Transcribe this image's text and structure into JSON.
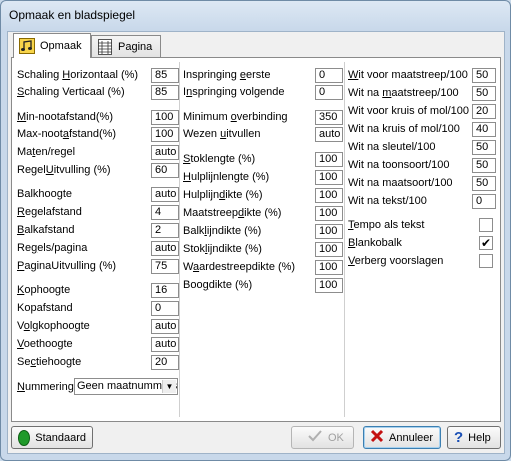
{
  "window": {
    "title": "Opmaak en bladspiegel"
  },
  "tabs": [
    {
      "label": "Opmaak"
    },
    {
      "label": "Pagina"
    }
  ],
  "col1": [
    {
      "pre": "Schaling ",
      "u": "H",
      "post": "orizontaal (%)",
      "value": "85"
    },
    {
      "pre": "",
      "u": "S",
      "post": "chaling Verticaal (%)",
      "value": "85"
    },
    {
      "pre": "",
      "u": "M",
      "post": "in-nootafstand(%)",
      "value": "100"
    },
    {
      "pre": "Max-noot",
      "u": "a",
      "post": "fstand(%)",
      "value": "100"
    },
    {
      "pre": "Ma",
      "u": "t",
      "post": "en/regel",
      "value": "auto"
    },
    {
      "pre": "Regel",
      "u": "U",
      "post": "itvulling (%)",
      "value": "60"
    },
    {
      "pre": "Balkhoogte",
      "u": "",
      "post": "",
      "value": "auto"
    },
    {
      "pre": "",
      "u": "R",
      "post": "egelafstand",
      "value": "4"
    },
    {
      "pre": "",
      "u": "B",
      "post": "alkafstand",
      "value": "2"
    },
    {
      "pre": "Re",
      "u": "g",
      "post": "els/pagina",
      "value": "auto"
    },
    {
      "pre": "",
      "u": "P",
      "post": "aginaUitvulling (%)",
      "value": "75"
    },
    {
      "pre": "",
      "u": "K",
      "post": "ophoogte",
      "value": "16"
    },
    {
      "pre": "Kopafstand",
      "u": "",
      "post": "",
      "value": "0"
    },
    {
      "pre": "V",
      "u": "o",
      "post": "lgkophoogte",
      "value": "auto"
    },
    {
      "pre": "",
      "u": "V",
      "post": "oethoogte",
      "value": "auto"
    },
    {
      "pre": "Se",
      "u": "c",
      "post": "tiehoogte",
      "value": "20"
    }
  ],
  "numbering": {
    "pre": "",
    "u": "N",
    "post": "ummering",
    "value": "Geen maatnummers"
  },
  "col2": [
    {
      "pre": "Inspringing ",
      "u": "e",
      "post": "erste",
      "value": "0"
    },
    {
      "pre": "I",
      "u": "n",
      "post": "springing volgende",
      "value": "0"
    },
    {
      "pre": "Minimum ",
      "u": "o",
      "post": "verbinding",
      "value": "350"
    },
    {
      "pre": "Wezen ",
      "u": "u",
      "post": "itvullen",
      "value": "auto"
    },
    {
      "pre": "",
      "u": "S",
      "post": "toklengte (%)",
      "value": "100"
    },
    {
      "pre": "",
      "u": "H",
      "post": "ulplijnlengte (%)",
      "value": "100"
    },
    {
      "pre": "Hulplijn",
      "u": "d",
      "post": "ikte (%)",
      "value": "100"
    },
    {
      "pre": "Maatstreep",
      "u": "d",
      "post": "ikte (%)",
      "value": "100"
    },
    {
      "pre": "Balk",
      "u": "l",
      "post": "ijndikte (%)",
      "value": "100"
    },
    {
      "pre": "Stok",
      "u": "l",
      "post": "ijndikte (%)",
      "value": "100"
    },
    {
      "pre": "W",
      "u": "a",
      "post": "ardestreepdikte (%)",
      "value": "100"
    },
    {
      "pre": "Boo",
      "u": "g",
      "post": "dikte (%)",
      "value": "100"
    }
  ],
  "col3": [
    {
      "pre": "",
      "u": "W",
      "post": "it voor maatstreep/100",
      "value": "50"
    },
    {
      "pre": "Wit na ",
      "u": "m",
      "post": "aatstreep/100",
      "value": "50"
    },
    {
      "pre": "Wit voor kruis of mol/100",
      "u": "",
      "post": "",
      "value": "20"
    },
    {
      "pre": "Wit na kruis of mol/100",
      "u": "",
      "post": "",
      "value": "40"
    },
    {
      "pre": "Wit na sleutel/100",
      "u": "",
      "post": "",
      "value": "50"
    },
    {
      "pre": "Wit na toonsoort/100",
      "u": "",
      "post": "",
      "value": "50"
    },
    {
      "pre": "Wit na maatsoort/100",
      "u": "",
      "post": "",
      "value": "50"
    },
    {
      "pre": "Wit na tekst/100",
      "u": "",
      "post": "",
      "value": "0"
    }
  ],
  "checks": [
    {
      "pre": "",
      "u": "T",
      "post": "empo als tekst",
      "checked": false
    },
    {
      "pre": "",
      "u": "B",
      "post": "lankobalk",
      "checked": true
    },
    {
      "pre": "",
      "u": "V",
      "post": "erberg voorslagen",
      "checked": false
    }
  ],
  "buttons": {
    "standaard": "Standaard",
    "ok": "OK",
    "annuleer": "Annuleer",
    "help": "Help"
  },
  "colors": {
    "green": "#1f9a2a",
    "red": "#c41010",
    "blue": "#1a4fb5"
  }
}
